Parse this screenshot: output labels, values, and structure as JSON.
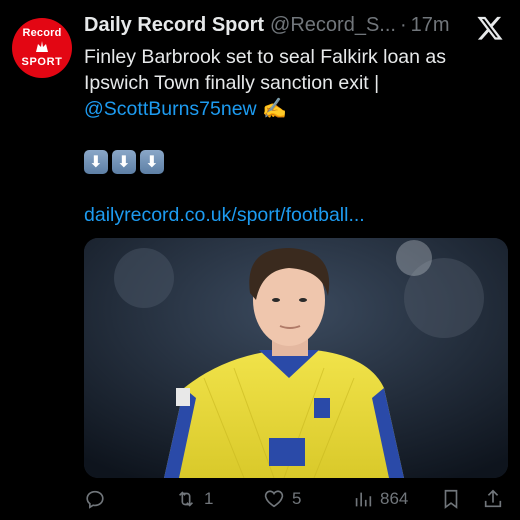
{
  "account": {
    "avatar_top": "Record",
    "avatar_bottom": "SPORT",
    "name": "Daily Record Sport",
    "handle": "@Record_S...",
    "separator": "·",
    "time": "17m"
  },
  "tweet": {
    "text": "Finley Barbrook set to seal Falkirk loan as Ipswich Town finally sanction exit |",
    "mention": "@ScottBurns75new",
    "hand_emoji": "✍️",
    "arrows": [
      "⬇",
      "⬇",
      "⬇"
    ],
    "link_text": "dailyrecord.co.uk/sport/football..."
  },
  "media": {
    "description_icon": "player-photo"
  },
  "actions": {
    "replies": "",
    "reposts": "1",
    "likes": "5",
    "views": "864"
  },
  "colors": {
    "background": "#000000",
    "text": "#e7e9ea",
    "muted": "#71767b",
    "link": "#1d9bf0",
    "avatar": "#e30613"
  }
}
